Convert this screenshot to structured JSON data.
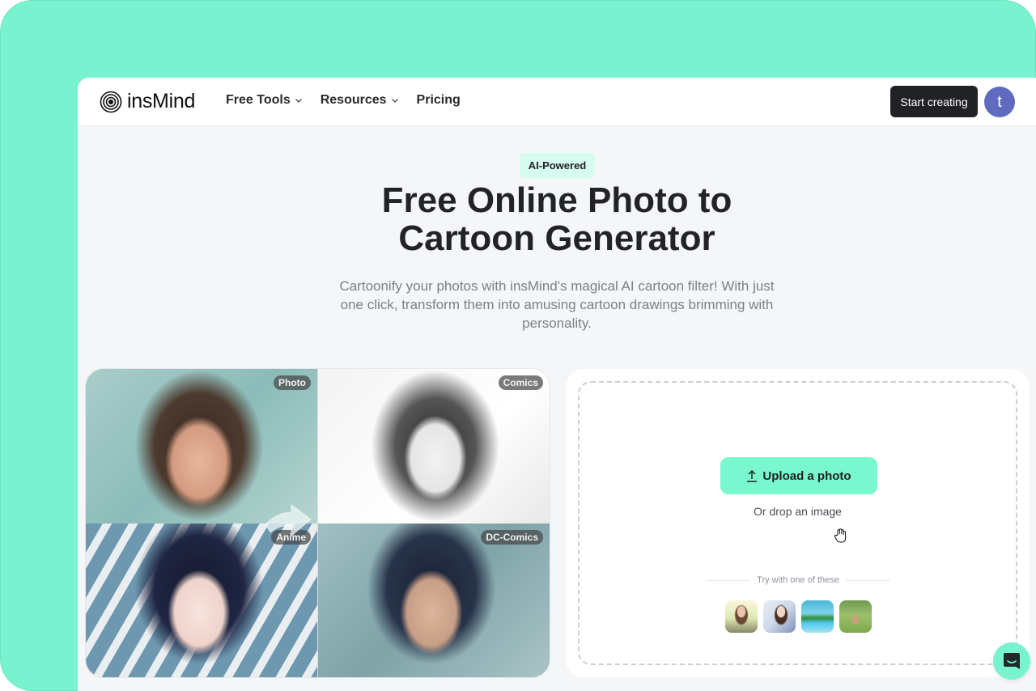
{
  "header": {
    "logo_text": "insMind",
    "nav": [
      {
        "label": "Free Tools",
        "has_dropdown": true
      },
      {
        "label": "Resources",
        "has_dropdown": true
      },
      {
        "label": "Pricing",
        "has_dropdown": false
      }
    ],
    "cta_label": "Start creating",
    "avatar_initial": "t"
  },
  "hero": {
    "badge": "AI-Powered",
    "title_line1": "Free Online Photo to",
    "title_line2": "Cartoon Generator",
    "subtitle": "Cartoonify your photos with insMind's magical AI cartoon filter! With just one click, transform them into amusing cartoon drawings brimming with personality."
  },
  "showcase": {
    "tiles": [
      {
        "label": "Photo"
      },
      {
        "label": "Comics"
      },
      {
        "label": "Anime"
      },
      {
        "label": "DC-Comics"
      }
    ]
  },
  "upload": {
    "button_label": "Upload a photo",
    "drop_text": "Or drop an image",
    "try_text": "Try with one of these",
    "samples": [
      "woman-in-field",
      "woman-sitting",
      "pool-resort",
      "dog-on-grass"
    ]
  },
  "colors": {
    "accent": "#79f3cf",
    "dark_button": "#212226",
    "avatar": "#5f6bbf",
    "badge_bg": "#d6fbef"
  }
}
